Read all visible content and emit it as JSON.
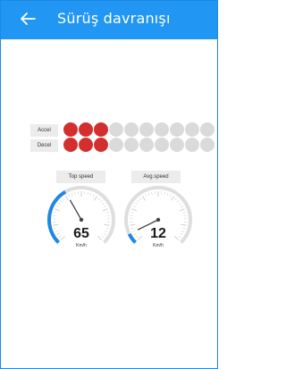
{
  "header": {
    "title": "Sürüş davranışı",
    "back_icon": "arrow-left-icon"
  },
  "behavior": {
    "accel": {
      "label": "Accel",
      "level": 3,
      "total": 10
    },
    "decel": {
      "label": "Decel",
      "level": 3,
      "total": 10
    }
  },
  "gauges": {
    "top_speed": {
      "label": "Top speed",
      "value": "65",
      "unit": "Km/h",
      "fraction": 0.39
    },
    "avg_speed": {
      "label": "Avg.speed",
      "value": "12",
      "unit": "Km/h",
      "fraction": 0.07
    }
  },
  "colors": {
    "appbar": "#2196f3",
    "active_dot": "#d32f2f",
    "inactive_dot": "#dadada",
    "gauge_fill": "#1e88e5",
    "gauge_track": "#dedede"
  }
}
